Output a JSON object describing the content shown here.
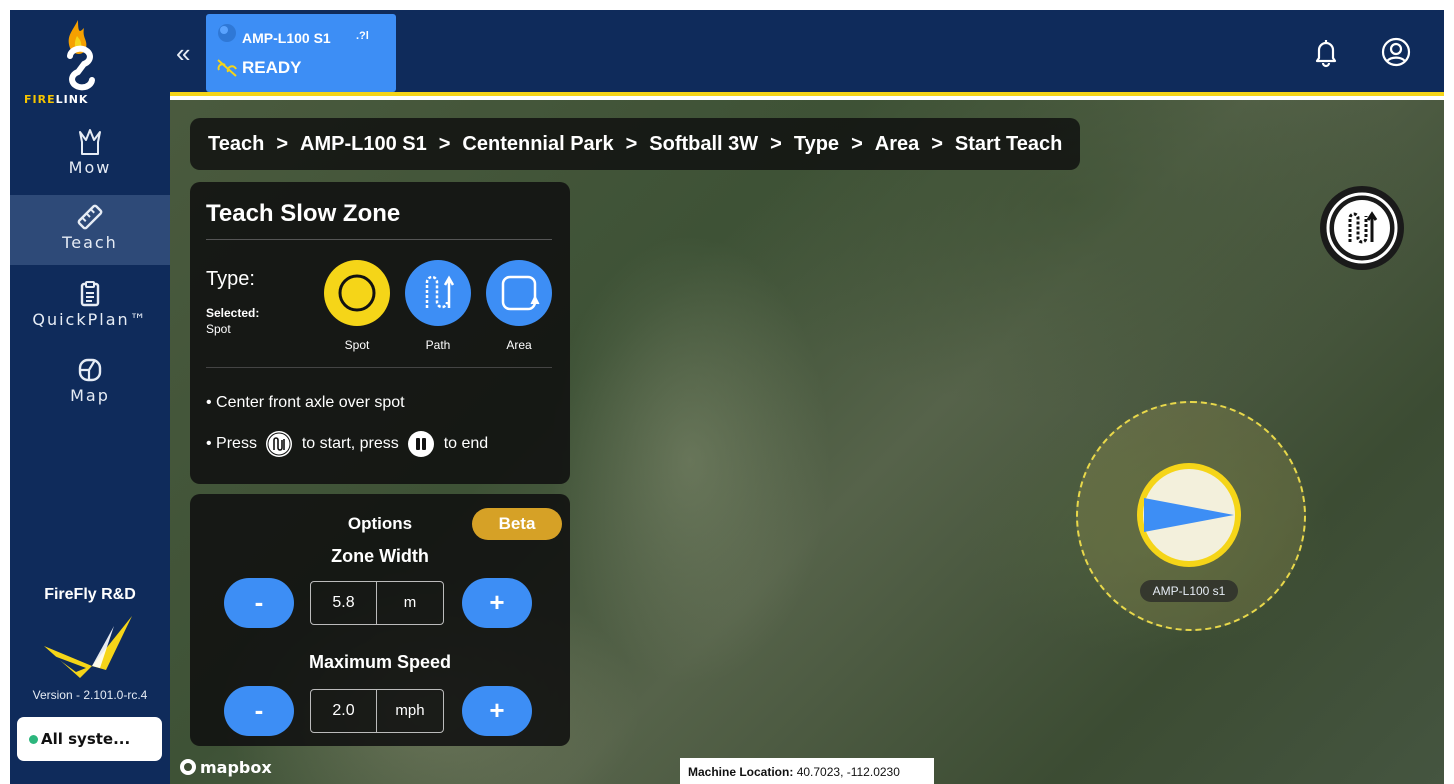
{
  "app": {
    "brand": "FIRELINK"
  },
  "sidebar": {
    "items": [
      {
        "label": "Mow",
        "icon": "mow-icon"
      },
      {
        "label": "Teach",
        "icon": "teach-icon",
        "active": true
      },
      {
        "label": "QuickPlan™",
        "icon": "quickplan-icon"
      },
      {
        "label": "Map",
        "icon": "map-icon"
      }
    ],
    "org_name": "FireFly R&D",
    "version": "Version - 2.101.0-rc.4",
    "status": "All syste..."
  },
  "header": {
    "machine_name": "AMP-L100 S1",
    "machine_signal": ".?l",
    "machine_state": "READY",
    "accent": "#f5d518"
  },
  "breadcrumb": [
    "Teach",
    "AMP-L100 S1",
    "Centennial Park",
    "Softball 3W",
    "Type",
    "Area",
    "Start Teach"
  ],
  "teach_panel": {
    "title": "Teach Slow Zone",
    "type_label": "Type:",
    "selected_label": "Selected:",
    "selected_value": "Spot",
    "types": [
      {
        "label": "Spot",
        "icon": "spot-icon",
        "color": "#f5d518",
        "selected": true
      },
      {
        "label": "Path",
        "icon": "path-icon",
        "color": "#3d8ef5"
      },
      {
        "label": "Area",
        "icon": "area-icon",
        "color": "#3d8ef5"
      }
    ],
    "instruction_1": "Center front axle over spot",
    "instruction_2_a": "Press",
    "instruction_2_b": "to start, press",
    "instruction_2_c": "to end"
  },
  "options_panel": {
    "title": "Options",
    "badge": "Beta",
    "zone_width": {
      "label": "Zone Width",
      "value": "5.8",
      "unit": "m"
    },
    "max_speed": {
      "label": "Maximum Speed",
      "value": "2.0",
      "unit": "mph"
    },
    "minus": "-",
    "plus": "+"
  },
  "map": {
    "attribution": "mapbox",
    "location_label": "Machine Location:",
    "location_value": "40.7023, -112.0230",
    "machine_label": "AMP-L100 s1"
  }
}
